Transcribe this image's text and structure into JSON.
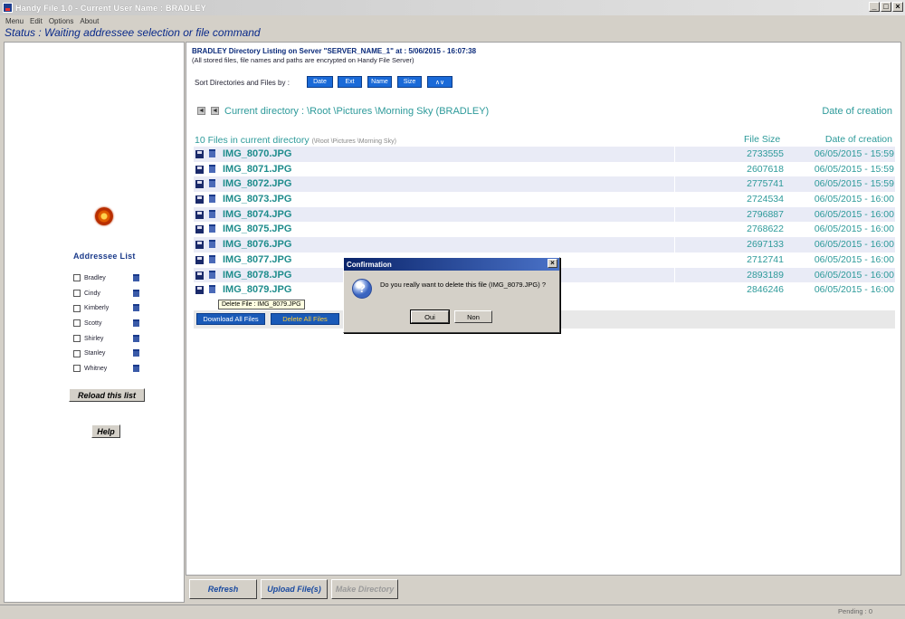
{
  "window": {
    "title": "Handy File 1.0 - Current User Name : BRADLEY",
    "controls": [
      "_",
      "□",
      "×"
    ]
  },
  "menu": [
    "Menu",
    "Edit",
    "Options",
    "About"
  ],
  "status": "Status : Waiting addressee selection or file command",
  "addressees": {
    "title": "Addressee List",
    "names": [
      "Bradley",
      "Cindy",
      "Kimberly",
      "Scotty",
      "Shirley",
      "Stanley",
      "Whitney"
    ],
    "reload_label": "Reload this list",
    "help_label": "Help"
  },
  "listing": {
    "title": "BRADLEY Directory Listing on Server \"SERVER_NAME_1\" at : 5/06/2015 - 16:07:38",
    "subtitle": "(All stored files, file names and paths are encrypted on Handy File Server)",
    "sort_label": "Sort Directories and Files by :",
    "sort_buttons": [
      "Date",
      "Ext",
      "Name",
      "Size",
      "∧∨"
    ],
    "current_dir": "Current directory : \\Root \\Pictures \\Morning Sky (BRADLEY)",
    "date_header_top": "Date of creation",
    "files_count": "10 Files in current directory",
    "files_path": "(\\Root \\Pictures \\Morning Sky)",
    "size_header": "File Size",
    "date_header": "Date of creation",
    "files": [
      {
        "name": "IMG_8070.JPG",
        "size": "2733555",
        "date": "06/05/2015 - 15:59"
      },
      {
        "name": "IMG_8071.JPG",
        "size": "2607618",
        "date": "06/05/2015 - 15:59"
      },
      {
        "name": "IMG_8072.JPG",
        "size": "2775741",
        "date": "06/05/2015 - 15:59"
      },
      {
        "name": "IMG_8073.JPG",
        "size": "2724534",
        "date": "06/05/2015 - 16:00"
      },
      {
        "name": "IMG_8074.JPG",
        "size": "2796887",
        "date": "06/05/2015 - 16:00"
      },
      {
        "name": "IMG_8075.JPG",
        "size": "2768622",
        "date": "06/05/2015 - 16:00"
      },
      {
        "name": "IMG_8076.JPG",
        "size": "2697133",
        "date": "06/05/2015 - 16:00"
      },
      {
        "name": "IMG_8077.JPG",
        "size": "2712741",
        "date": "06/05/2015 - 16:00"
      },
      {
        "name": "IMG_8078.JPG",
        "size": "2893189",
        "date": "06/05/2015 - 16:00"
      },
      {
        "name": "IMG_8079.JPG",
        "size": "2846246",
        "date": "06/05/2015 - 16:00"
      }
    ],
    "tooltip": "Delete File : IMG_8079.JPG",
    "download_all": "Download All Files",
    "delete_all": "Delete All Files"
  },
  "bottom": {
    "refresh": "Refresh",
    "upload": "Upload File(s)",
    "make_dir": "Make Directory"
  },
  "statusbar": {
    "pending": "Pending : 0"
  },
  "dialog": {
    "title": "Confirmation",
    "close": "×",
    "icon": "?",
    "message": "Do you really want to delete this file (IMG_8079.JPG) ?",
    "yes": "Oui",
    "no": "Non"
  },
  "colors": {
    "accent": "#1a6ad8",
    "teal": "#2d9a9a",
    "status": "#0a2a8a"
  },
  "icons": [
    "app-icon",
    "logo-icon",
    "trash-icon",
    "floppy-icon",
    "arrow-left-icon",
    "question-icon",
    "close-icon"
  ]
}
